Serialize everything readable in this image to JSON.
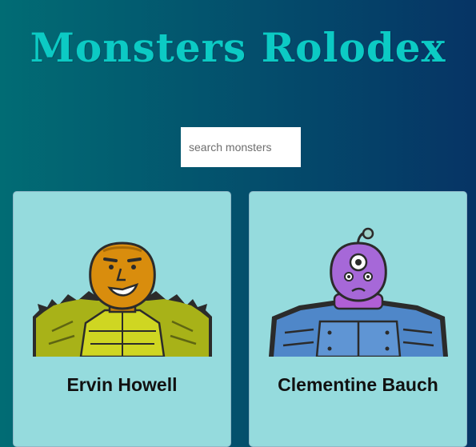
{
  "app": {
    "title": "Monsters Rolodex"
  },
  "search": {
    "placeholder": "search monsters",
    "value": ""
  },
  "monsters": [
    {
      "name": "Ervin Howell",
      "avatar": "green-muscular-monster-icon"
    },
    {
      "name": "Clementine Bauch",
      "avatar": "purple-cyclops-robot-monster-icon"
    }
  ],
  "colors": {
    "background_start": "#016c74",
    "background_end": "#063465",
    "title": "#0ccac4",
    "card_background": "#95dbdd"
  }
}
